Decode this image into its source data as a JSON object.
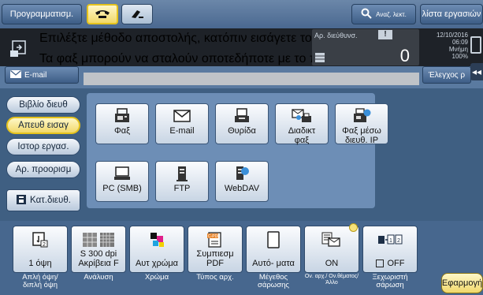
{
  "topbar": {
    "program_label": "Προγραμματισμ.",
    "search_label": "Αναζ. λεκτ.",
    "list_label": "λίστα εργασιών"
  },
  "message": {
    "line1": "Επιλέξτε μέθοδο αποστολής, κατόπιν εισάγετε τον επιθ προορ.",
    "line2": "Τα φαξ μπορούν να σταλούν οποτεδήποτε με το πληκτρολόγιο",
    "dest_count_label": "Αρ. διεύθυνσ.",
    "dest_count": "0",
    "date": "12/10/2016",
    "time": "06:09",
    "memory_label": "Μνήμη",
    "memory_value": "100%",
    "check_label": "Έλεγχος ρ"
  },
  "address": {
    "email_label": "E-mail"
  },
  "sidebar": {
    "items": [
      "Βιβλίο διευθ",
      "Απευθ εισαγ",
      "Ιστορ εργασ.",
      "Αρ. προορισμ",
      "Κατ.διευθ."
    ]
  },
  "tiles": [
    {
      "label": "Φαξ",
      "icon": "fax-icon"
    },
    {
      "label": "E-mail",
      "icon": "envelope-icon"
    },
    {
      "label": "Θυρίδα",
      "icon": "box-icon"
    },
    {
      "label": "Διαδικτ φαξ",
      "icon": "internet-fax-icon"
    },
    {
      "label": "Φαξ μέσω διευθ. IP",
      "icon": "ip-fax-icon"
    },
    {
      "label": "PC (SMB)",
      "icon": "pc-icon"
    },
    {
      "label": "FTP",
      "icon": "ftp-server-icon"
    },
    {
      "label": "WebDAV",
      "icon": "webdav-server-icon"
    }
  ],
  "bottom": {
    "settings": [
      {
        "value": "1 όψη",
        "caption": "Απλή όψη/ διπλή όψη"
      },
      {
        "value": "S 300 dpi Ακρίβεια F",
        "caption": "Ανάλυση"
      },
      {
        "value": "Αυτ χρώμα",
        "caption": "Χρώμα"
      },
      {
        "value": "Συμπιεσμ PDF",
        "caption": "Τύπος αρχ."
      },
      {
        "value": "Αυτό- ματα",
        "caption": "Μέγεθος σάρωσης"
      },
      {
        "value": "ON",
        "caption": "Ον. αρχ./ Ον.θέματος/ Άλλο"
      },
      {
        "value": "OFF",
        "caption": "Ξεχωριστή σάρωση"
      }
    ],
    "apply_label": "Εφαρμογή"
  },
  "colors": {
    "accent_yellow": "#f1d86a",
    "background_blue": "#3f5f82",
    "message_bg": "#1e2228"
  }
}
